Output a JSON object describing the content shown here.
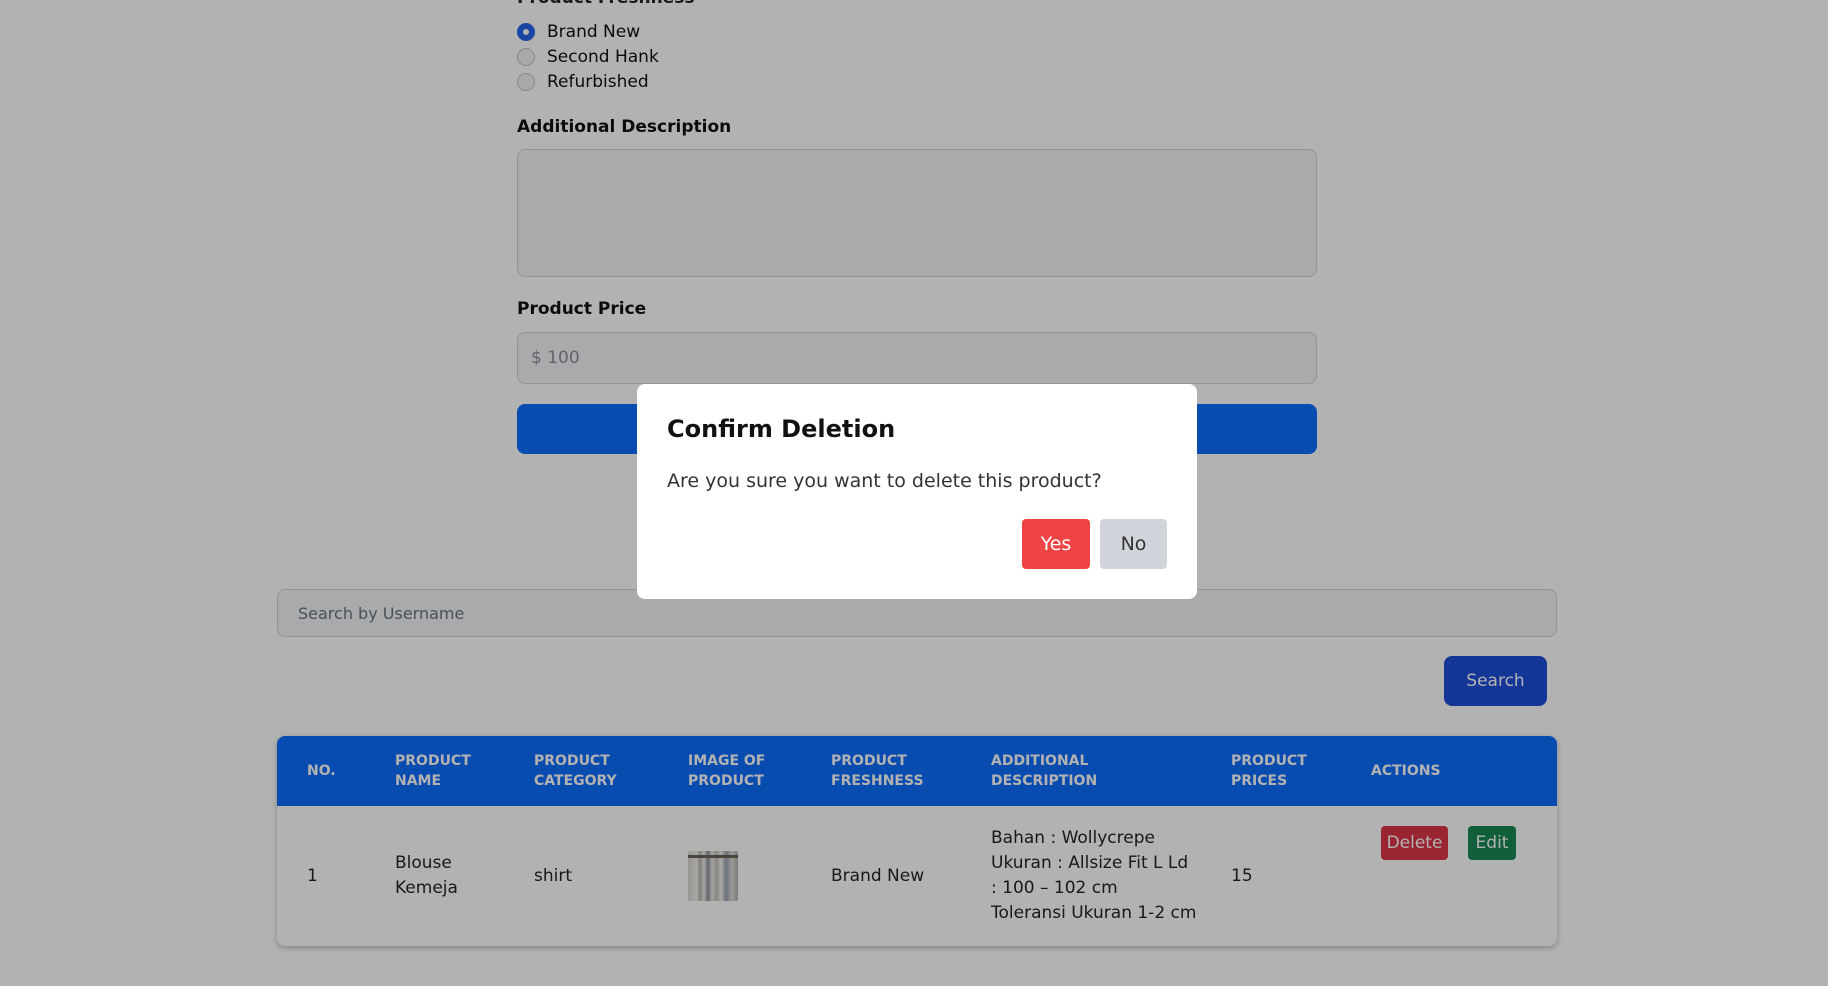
{
  "form": {
    "freshness_title": "Product Freshness",
    "freshness_options": [
      {
        "label": "Brand New",
        "checked": true
      },
      {
        "label": "Second Hank",
        "checked": false
      },
      {
        "label": "Refurbished",
        "checked": false
      }
    ],
    "description_label": "Additional Description",
    "description_value": "",
    "price_label": "Product Price",
    "price_placeholder": "$ 100",
    "submit_label": ""
  },
  "search": {
    "placeholder": "Search by Username",
    "button_label": "Search"
  },
  "table": {
    "columns": [
      "No.",
      "Product\nName",
      "Product\nCategory",
      "Image of\nProduct",
      "Product\nFreshness",
      "Additional\nDescription",
      "Product\nPrices",
      "Actions"
    ],
    "rows": [
      {
        "no": "1",
        "name": "Blouse\nKemeja",
        "category": "shirt",
        "image": "blouse-product-thumbnail",
        "freshness": "Brand New",
        "description": "Bahan : Wollycrepe\nUkuran : Allsize Fit L Ld\n: 100 – 102 cm\nToleransi Ukuran 1-2 cm",
        "price": "15",
        "delete_label": "Delete",
        "edit_label": "Edit"
      }
    ]
  },
  "modal": {
    "title": "Confirm Deletion",
    "message": "Are you sure you want to delete this product?",
    "yes_label": "Yes",
    "no_label": "No"
  },
  "colors": {
    "primary": "#0d6efd",
    "search_button": "#1d4ed8",
    "delete": "#dc3545",
    "edit": "#198754",
    "modal_yes": "#ef4444",
    "modal_no": "#d1d5db",
    "radio_checked": "#2563eb"
  }
}
